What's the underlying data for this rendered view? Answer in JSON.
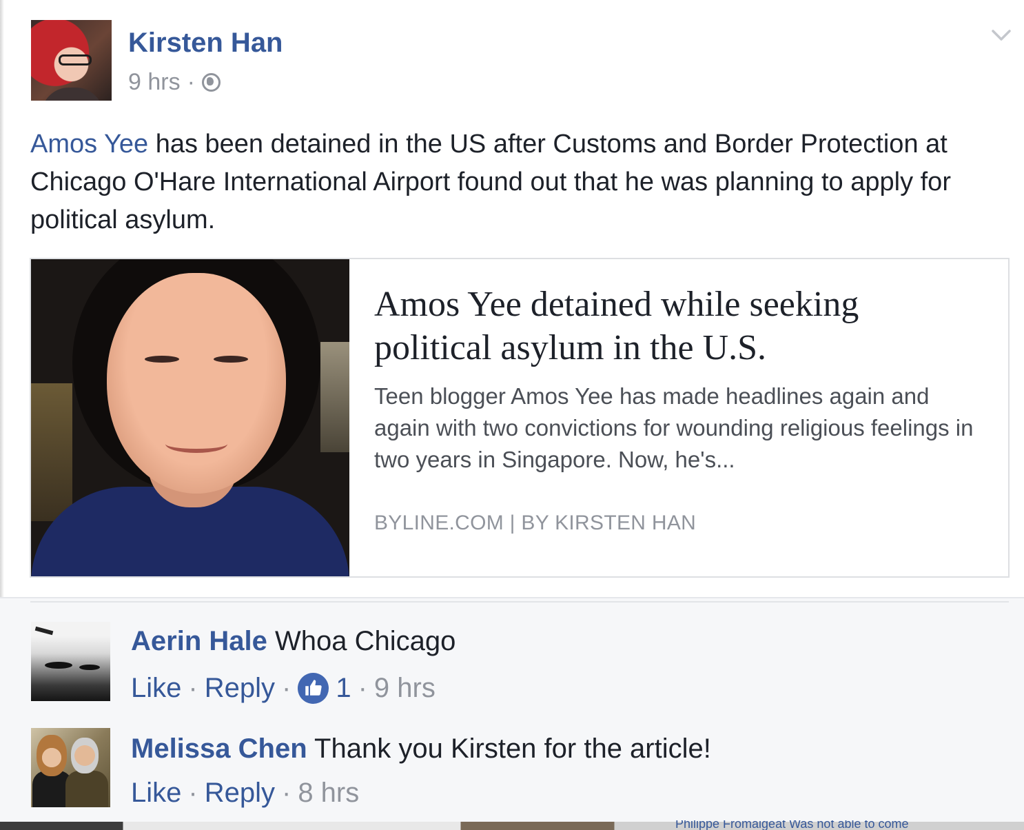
{
  "post": {
    "author": "Kirsten Han",
    "time": "9 hrs",
    "meta_sep": "·",
    "privacy_icon": "globe-icon",
    "options_icon": "chevron-down-icon",
    "mention": "Amos Yee",
    "text_rest": " has been detained in the US after Customs and Border Protection at Chicago O'Hare International Airport found out that he was planning to apply for political asylum."
  },
  "link_card": {
    "title": "Amos Yee detained while seeking political asylum in the U.S.",
    "description": "Teen blogger Amos Yee has made headlines again and again with two convictions for wounding religious feelings in two years in Singapore. Now, he's...",
    "source": "BYLINE.COM | BY KIRSTEN HAN"
  },
  "comments": [
    {
      "author": "Aerin Hale",
      "text": "Whoa Chicago",
      "like_label": "Like",
      "reply_label": "Reply",
      "sep": "·",
      "like_count": "1",
      "time": "9 hrs"
    },
    {
      "author": "Melissa Chen",
      "text": "Thank you Kirsten for the article!",
      "like_label": "Like",
      "reply_label": "Reply",
      "sep": "·",
      "time": "8 hrs"
    }
  ],
  "partial_next": "Philippe Fromaigeat Was not able to come",
  "colors": {
    "link_blue": "#365899",
    "meta_gray": "#90949c",
    "like_badge": "#4267b2",
    "comment_bg": "#f6f7f9"
  }
}
